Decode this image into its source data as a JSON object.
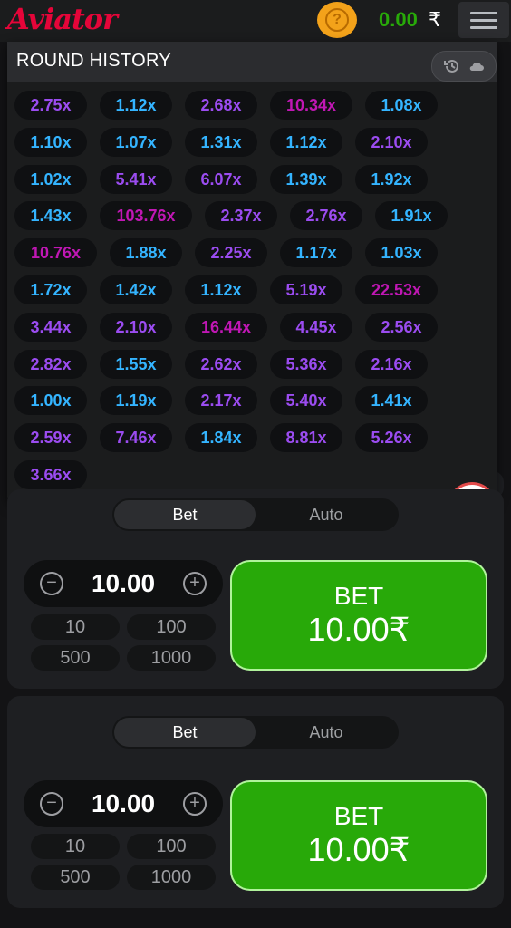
{
  "header": {
    "logo": "Aviator",
    "help_icon": "?",
    "balance": "0.00",
    "currency": "₹"
  },
  "history": {
    "title": "ROUND HISTORY",
    "rows": [
      [
        {
          "v": "2.75x",
          "c": "#9b4cf0"
        },
        {
          "v": "1.12x",
          "c": "#34b4ff"
        },
        {
          "v": "2.68x",
          "c": "#9b4cf0"
        },
        {
          "v": "10.34x",
          "c": "#c017b4"
        },
        {
          "v": "1.08x",
          "c": "#34b4ff"
        }
      ],
      [
        {
          "v": "1.10x",
          "c": "#34b4ff"
        },
        {
          "v": "1.07x",
          "c": "#34b4ff"
        },
        {
          "v": "1.31x",
          "c": "#34b4ff"
        },
        {
          "v": "1.12x",
          "c": "#34b4ff"
        },
        {
          "v": "2.10x",
          "c": "#9b4cf0"
        }
      ],
      [
        {
          "v": "1.02x",
          "c": "#34b4ff"
        },
        {
          "v": "5.41x",
          "c": "#9b4cf0"
        },
        {
          "v": "6.07x",
          "c": "#9b4cf0"
        },
        {
          "v": "1.39x",
          "c": "#34b4ff"
        },
        {
          "v": "1.92x",
          "c": "#34b4ff"
        }
      ],
      [
        {
          "v": "1.43x",
          "c": "#34b4ff"
        },
        {
          "v": "103.76x",
          "c": "#c017b4"
        },
        {
          "v": "2.37x",
          "c": "#9b4cf0"
        },
        {
          "v": "2.76x",
          "c": "#9b4cf0"
        },
        {
          "v": "1.91x",
          "c": "#34b4ff"
        }
      ],
      [
        {
          "v": "10.76x",
          "c": "#c017b4"
        },
        {
          "v": "1.88x",
          "c": "#34b4ff"
        },
        {
          "v": "2.25x",
          "c": "#9b4cf0"
        },
        {
          "v": "1.17x",
          "c": "#34b4ff"
        },
        {
          "v": "1.03x",
          "c": "#34b4ff"
        }
      ],
      [
        {
          "v": "1.72x",
          "c": "#34b4ff"
        },
        {
          "v": "1.42x",
          "c": "#34b4ff"
        },
        {
          "v": "1.12x",
          "c": "#34b4ff"
        },
        {
          "v": "5.19x",
          "c": "#9b4cf0"
        },
        {
          "v": "22.53x",
          "c": "#c017b4"
        }
      ],
      [
        {
          "v": "3.44x",
          "c": "#9b4cf0"
        },
        {
          "v": "2.10x",
          "c": "#9b4cf0"
        },
        {
          "v": "16.44x",
          "c": "#c017b4"
        },
        {
          "v": "4.45x",
          "c": "#9b4cf0"
        },
        {
          "v": "2.56x",
          "c": "#9b4cf0"
        }
      ],
      [
        {
          "v": "2.82x",
          "c": "#9b4cf0"
        },
        {
          "v": "1.55x",
          "c": "#34b4ff"
        },
        {
          "v": "2.62x",
          "c": "#9b4cf0"
        },
        {
          "v": "5.36x",
          "c": "#9b4cf0"
        },
        {
          "v": "2.16x",
          "c": "#9b4cf0"
        }
      ],
      [
        {
          "v": "1.00x",
          "c": "#34b4ff"
        },
        {
          "v": "1.19x",
          "c": "#34b4ff"
        },
        {
          "v": "2.17x",
          "c": "#9b4cf0"
        },
        {
          "v": "5.40x",
          "c": "#9b4cf0"
        },
        {
          "v": "1.41x",
          "c": "#34b4ff"
        }
      ],
      [
        {
          "v": "2.59x",
          "c": "#9b4cf0"
        },
        {
          "v": "7.46x",
          "c": "#9b4cf0"
        },
        {
          "v": "1.84x",
          "c": "#34b4ff"
        },
        {
          "v": "8.81x",
          "c": "#9b4cf0"
        },
        {
          "v": "5.26x",
          "c": "#9b4cf0"
        }
      ],
      [
        {
          "v": "3.66x",
          "c": "#9b4cf0"
        }
      ]
    ]
  },
  "bet1": {
    "tab_bet": "Bet",
    "tab_auto": "Auto",
    "amount": "10.00",
    "minus": "−",
    "plus": "+",
    "quick": [
      "10",
      "100",
      "500",
      "1000"
    ],
    "button_label": "BET",
    "button_amount": "10.00₹"
  },
  "bet2": {
    "tab_bet": "Bet",
    "tab_auto": "Auto",
    "amount": "10.00",
    "minus": "−",
    "plus": "+",
    "quick": [
      "10",
      "100",
      "500",
      "1000"
    ],
    "button_label": "BET",
    "button_amount": "10.00₹"
  },
  "colors": {
    "brand_red": "#e50539",
    "bet_green": "#28a909",
    "mult_blue": "#34b4ff",
    "mult_purple": "#9b4cf0",
    "mult_magenta": "#c017b4"
  }
}
